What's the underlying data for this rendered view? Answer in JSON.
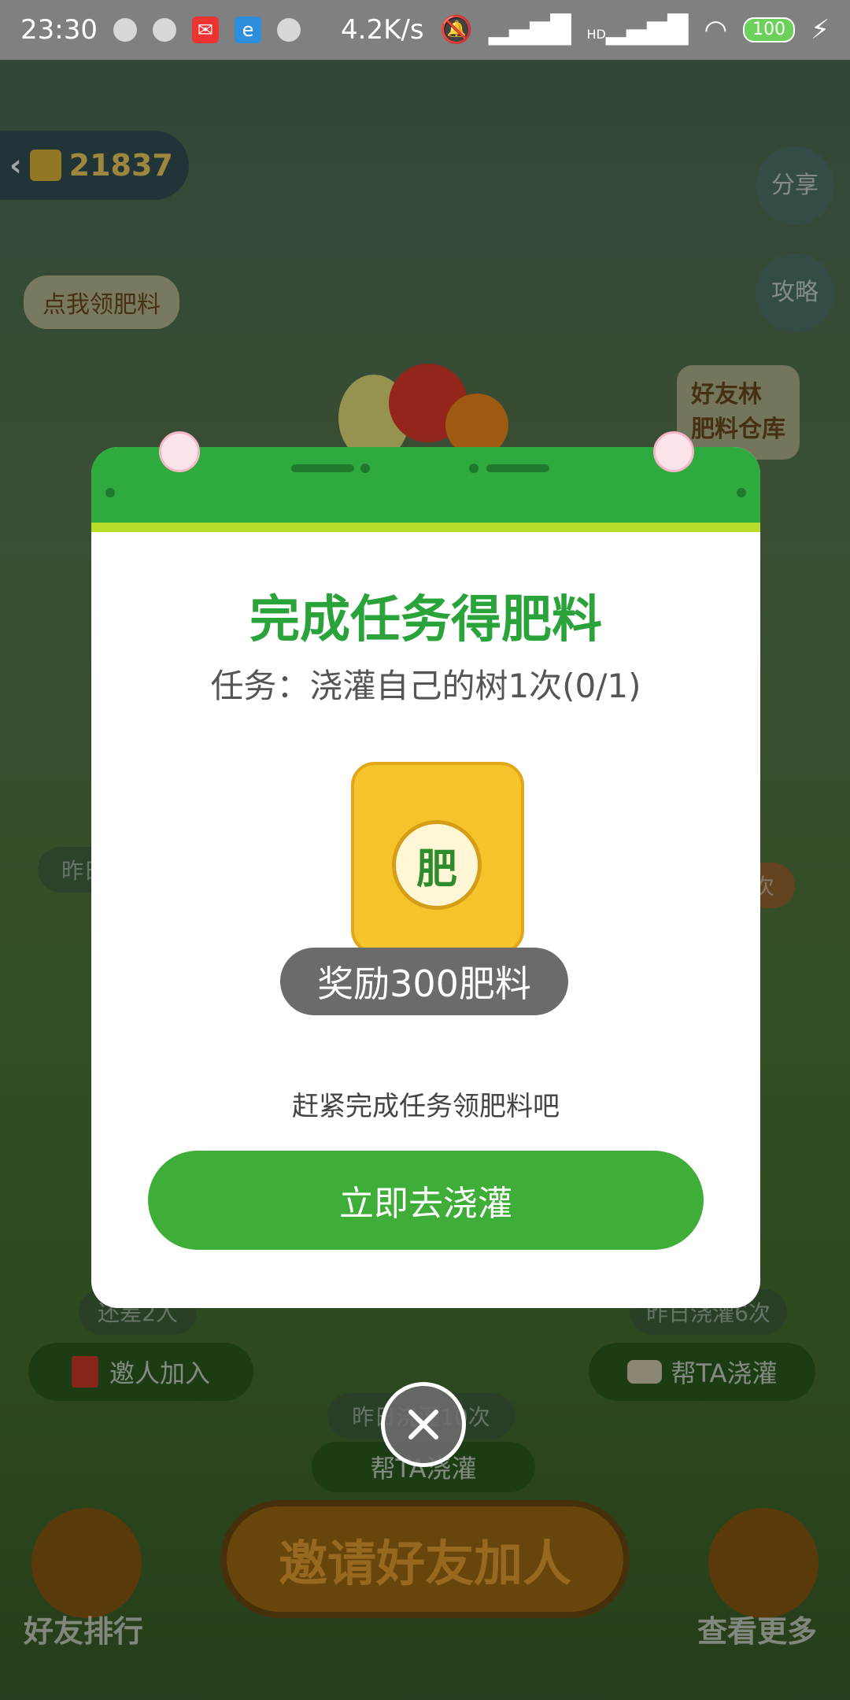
{
  "statusbar": {
    "time": "23:30",
    "network_speed": "4.2K/s",
    "battery": "100",
    "signal_hd_label": "HD",
    "icons": [
      "wechat-icon",
      "notification-icon",
      "mail-icon",
      "browser-icon",
      "notification-icon",
      "mute-bell-icon",
      "signal-icon",
      "hd-signal-icon",
      "wifi-icon",
      "battery-icon",
      "charging-icon"
    ]
  },
  "background": {
    "coin_balance": "21837",
    "share_label": "分享",
    "guide_label": "攻略",
    "claim_fertilizer_label": "点我领肥料",
    "side_note_line1": "好友林",
    "side_note_line2": "肥料仓库",
    "yesterday_watering_left": "昨日浇灌",
    "still_short": "还差2人",
    "invite_join": "邀人加入",
    "yesterday_watering_right": "昨日浇灌6次",
    "help_water_right": "帮TA浇灌",
    "yesterday_watering_center": "昨日浇灌10次",
    "help_water_center": "帮TA浇灌",
    "invite_friends_big": "邀请好友加人",
    "friend_ranking": "好友排行",
    "view_more": "查看更多",
    "times_suffix": "次",
    "fertilizer_char": "肥"
  },
  "modal": {
    "title": "完成任务得肥料",
    "task": "任务：浇灌自己的树1次(0/1)",
    "bag_label": "肥",
    "reward": "奖励300肥料",
    "hint": "赶紧完成任务领肥料吧",
    "cta": "立即去浇灌"
  },
  "colors": {
    "accent_green": "#3fae38",
    "title_green": "#2aa33a",
    "header_green": "#2faa3f"
  }
}
